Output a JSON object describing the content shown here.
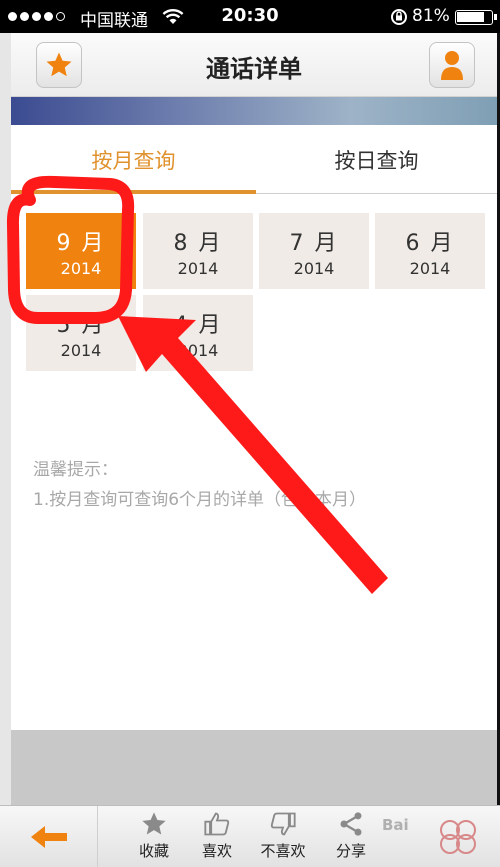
{
  "status_bar": {
    "carrier": "中国联通",
    "time": "20:30",
    "battery_text": "81%",
    "battery_level": 0.81,
    "signal_dots_filled": 4,
    "signal_dots_total": 5
  },
  "header": {
    "title": "通话详单",
    "left_icon": "star-icon",
    "right_icon": "person-icon"
  },
  "tabs": [
    {
      "label": "按月查询",
      "active": true
    },
    {
      "label": "按日查询",
      "active": false
    }
  ],
  "months": [
    {
      "month": "9 月",
      "year": "2014",
      "selected": true
    },
    {
      "month": "8 月",
      "year": "2014",
      "selected": false
    },
    {
      "month": "7 月",
      "year": "2014",
      "selected": false
    },
    {
      "month": "6 月",
      "year": "2014",
      "selected": false
    },
    {
      "month": "5 月",
      "year": "2014",
      "selected": false
    },
    {
      "month": "4 月",
      "year": "2014",
      "selected": false
    }
  ],
  "tips": {
    "title": "温馨提示：",
    "lines": [
      "1.按月查询可查询6个月的详单（包含本月）"
    ]
  },
  "bottom_bar": {
    "back_icon": "arrow-left-icon",
    "items": [
      {
        "label": "收藏",
        "icon": "star-icon"
      },
      {
        "label": "喜欢",
        "icon": "thumbs-up-icon"
      },
      {
        "label": "不喜欢",
        "icon": "thumbs-down-icon"
      },
      {
        "label": "分享",
        "icon": "share-icon"
      }
    ],
    "watermark": "Bai"
  },
  "colors": {
    "accent": "#f0820f",
    "tab_active": "#e0922e",
    "cell_bg": "#f0ebe6",
    "annotation_red": "#ff1a1a"
  }
}
